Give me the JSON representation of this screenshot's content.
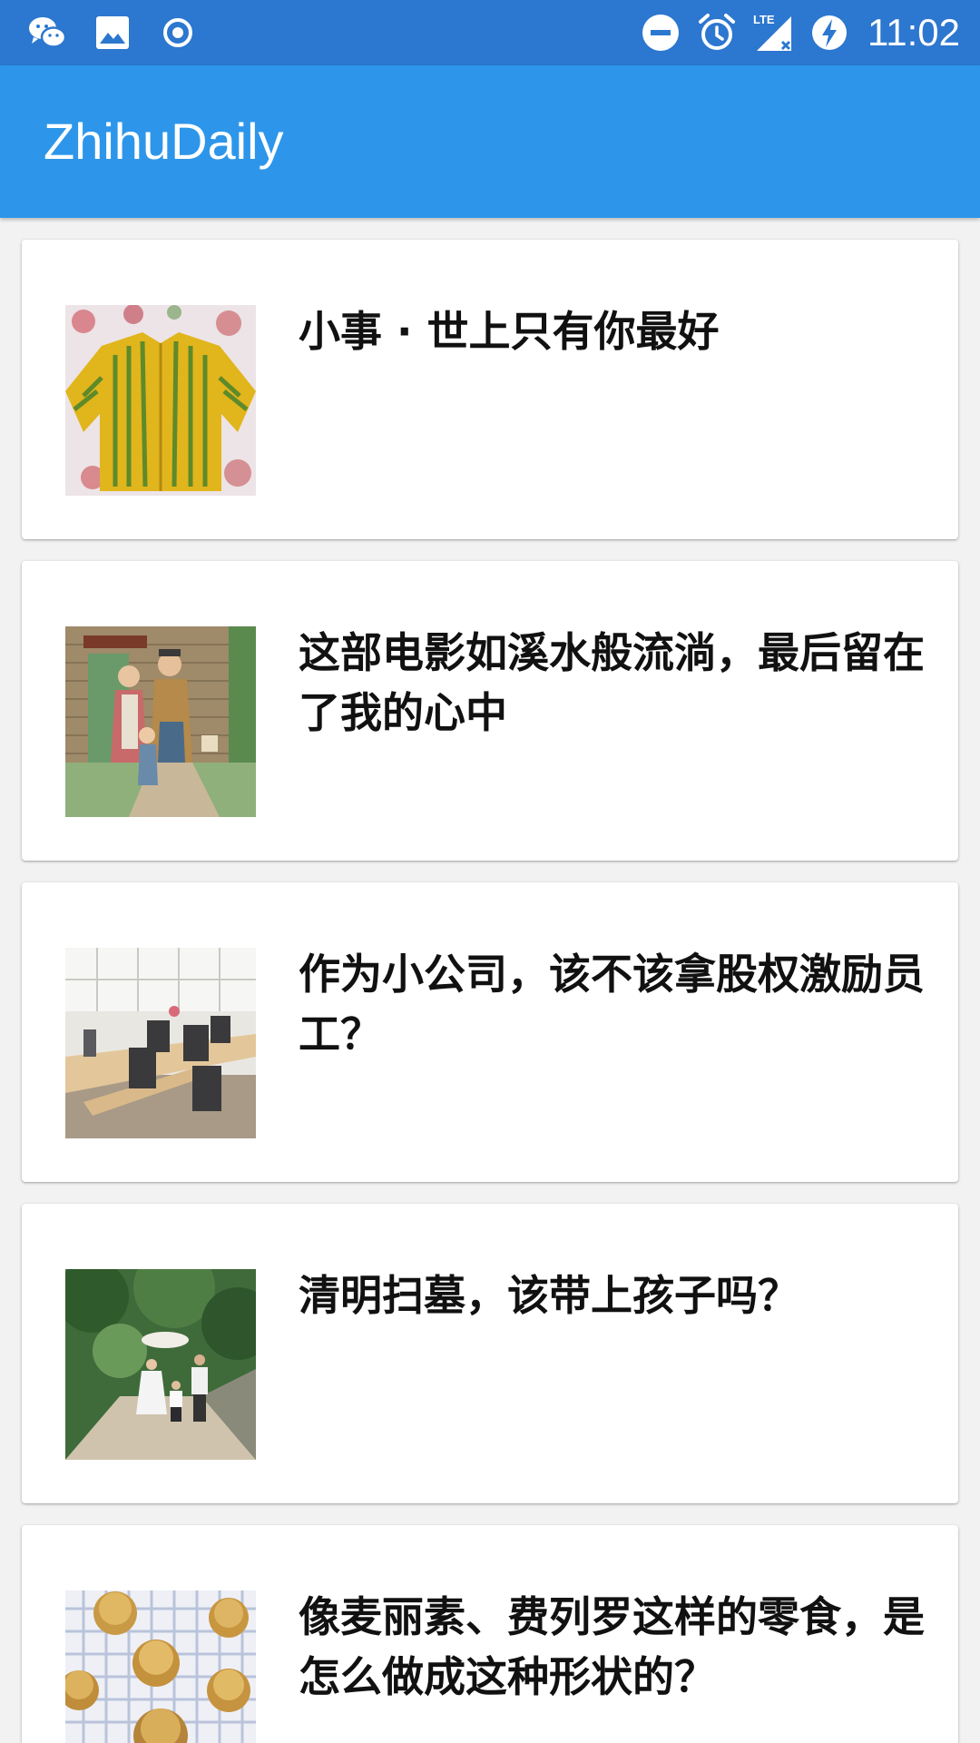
{
  "status_bar": {
    "time": "11:02",
    "network": "LTE",
    "icons": [
      "wechat-icon",
      "image-icon",
      "record-icon",
      "do-not-disturb-icon",
      "alarm-icon",
      "lte-signal-icon",
      "battery-charging-icon"
    ]
  },
  "app_bar": {
    "title": "ZhihuDaily",
    "color": "#2d96ea"
  },
  "stories": [
    {
      "title": "小事 · 世上只有你最好",
      "thumbnail": "yellow-sweater-thumbnail"
    },
    {
      "title": "这部电影如溪水般流淌，最后留在了我的心中",
      "thumbnail": "family-illustration-thumbnail"
    },
    {
      "title": "作为小公司，该不该拿股权激励员工？",
      "thumbnail": "office-thumbnail"
    },
    {
      "title": "清明扫墓，该带上孩子吗？",
      "thumbnail": "family-walk-thumbnail"
    },
    {
      "title": "像麦丽素、费列罗这样的零食，是怎么做成这种形状的？",
      "thumbnail": "chocolates-thumbnail"
    }
  ],
  "colors": {
    "status_bar": "#2c77cf",
    "app_bar": "#2d96ea",
    "background": "#f2f2f2"
  }
}
